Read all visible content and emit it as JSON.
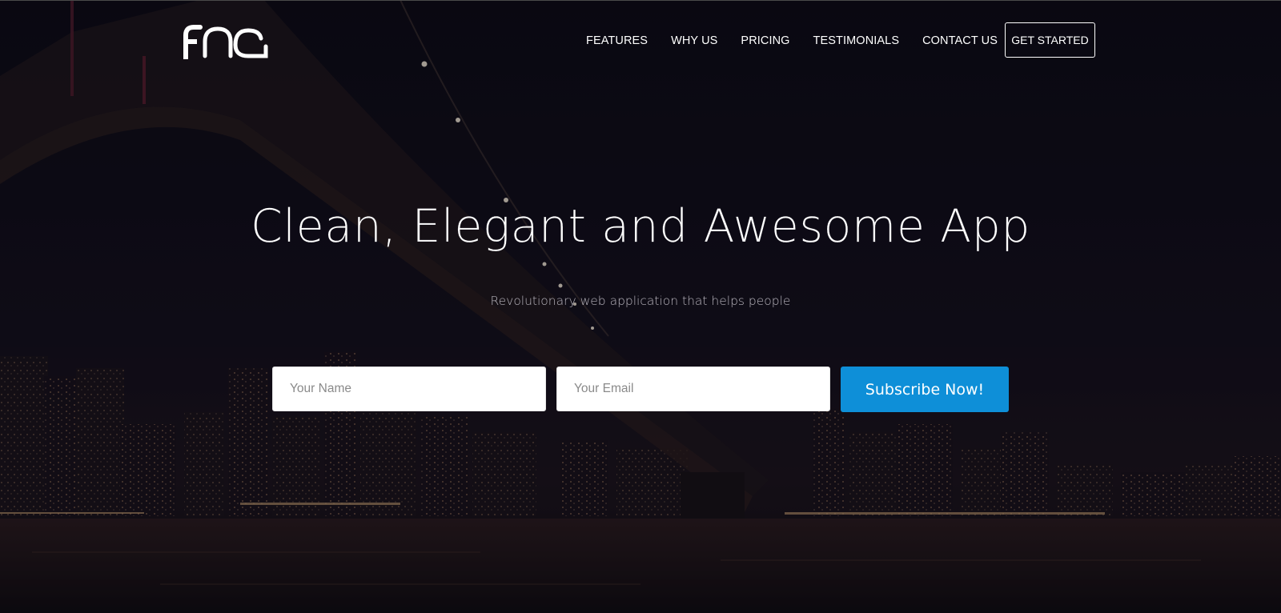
{
  "brand": {
    "logo_text": "FOG"
  },
  "nav": {
    "links": [
      {
        "label": "FEATURES"
      },
      {
        "label": "WHY US"
      },
      {
        "label": "PRICING"
      },
      {
        "label": "TESTIMONIALS"
      },
      {
        "label": "CONTACT US"
      }
    ],
    "cta_label": "GET STARTED"
  },
  "hero": {
    "headline": "Clean, Elegant and Awesome App",
    "subheadline": "Revolutionary web application that helps people"
  },
  "form": {
    "name_placeholder": "Your Name",
    "email_placeholder": "Your Email",
    "name_value": "",
    "email_value": "",
    "submit_label": "Subscribe Now!"
  },
  "colors": {
    "accent": "#0e8fd8",
    "background": "#0d0b14",
    "text": "#ffffff"
  }
}
